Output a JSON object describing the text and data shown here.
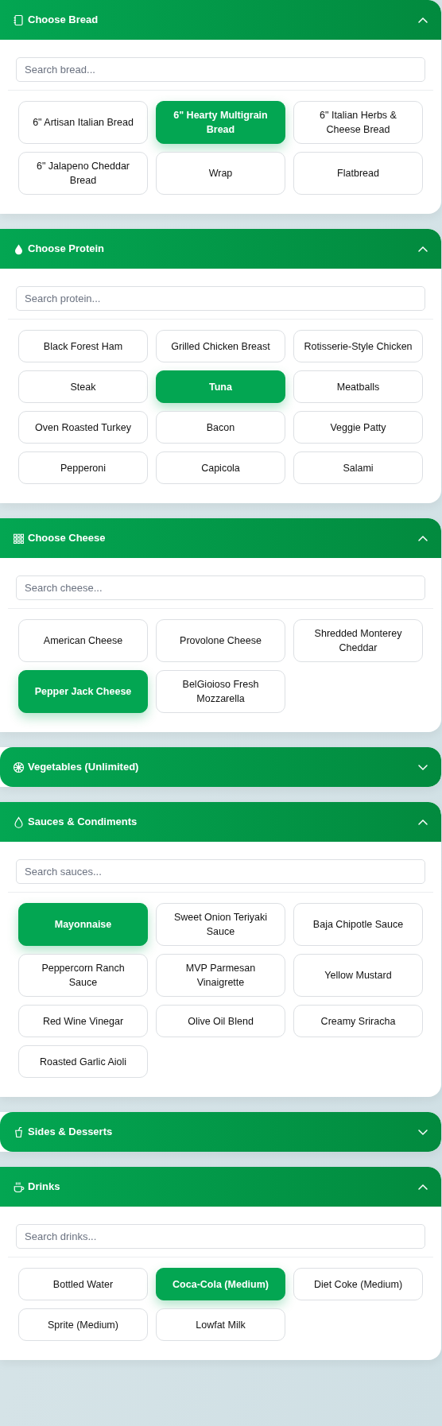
{
  "sections": [
    {
      "title": "Choose Bread",
      "expanded": true,
      "search": {
        "placeholder": "Search bread..."
      },
      "options": [
        {
          "label": "6\" Artisan Italian Bread",
          "selected": false
        },
        {
          "label": "6\" Hearty Multigrain Bread",
          "selected": true
        },
        {
          "label": "6\" Italian Herbs & Cheese Bread",
          "selected": false
        },
        {
          "label": "6\" Jalapeno Cheddar Bread",
          "selected": false
        },
        {
          "label": "Wrap",
          "selected": false
        },
        {
          "label": "Flatbread",
          "selected": false
        }
      ]
    },
    {
      "title": "Choose Protein",
      "expanded": true,
      "search": {
        "placeholder": "Search protein..."
      },
      "options": [
        {
          "label": "Black Forest Ham",
          "selected": false
        },
        {
          "label": "Grilled Chicken Breast",
          "selected": false
        },
        {
          "label": "Rotisserie-Style Chicken",
          "selected": false
        },
        {
          "label": "Steak",
          "selected": false
        },
        {
          "label": "Tuna",
          "selected": true
        },
        {
          "label": "Meatballs",
          "selected": false
        },
        {
          "label": "Oven Roasted Turkey",
          "selected": false
        },
        {
          "label": "Bacon",
          "selected": false
        },
        {
          "label": "Veggie Patty",
          "selected": false
        },
        {
          "label": "Pepperoni",
          "selected": false
        },
        {
          "label": "Capicola",
          "selected": false
        },
        {
          "label": "Salami",
          "selected": false
        }
      ]
    },
    {
      "title": "Choose Cheese",
      "expanded": true,
      "search": {
        "placeholder": "Search cheese..."
      },
      "options": [
        {
          "label": "American Cheese",
          "selected": false
        },
        {
          "label": "Provolone Cheese",
          "selected": false
        },
        {
          "label": "Shredded Monterey Cheddar",
          "selected": false
        },
        {
          "label": "Pepper Jack Cheese",
          "selected": true
        },
        {
          "label": "BelGioioso Fresh Mozzarella",
          "selected": false
        }
      ]
    },
    {
      "title": "Vegetables (Unlimited)",
      "expanded": false
    },
    {
      "title": "Sauces & Condiments",
      "expanded": true,
      "search": {
        "placeholder": "Search sauces..."
      },
      "options": [
        {
          "label": "Mayonnaise",
          "selected": true
        },
        {
          "label": "Sweet Onion Teriyaki Sauce",
          "selected": false
        },
        {
          "label": "Baja Chipotle Sauce",
          "selected": false
        },
        {
          "label": "Peppercorn Ranch Sauce",
          "selected": false
        },
        {
          "label": "MVP Parmesan Vinaigrette",
          "selected": false
        },
        {
          "label": "Yellow Mustard",
          "selected": false
        },
        {
          "label": "Red Wine Vinegar",
          "selected": false
        },
        {
          "label": "Olive Oil Blend",
          "selected": false
        },
        {
          "label": "Creamy Sriracha",
          "selected": false
        },
        {
          "label": "Roasted Garlic Aioli",
          "selected": false
        }
      ]
    },
    {
      "title": "Sides & Desserts",
      "expanded": false
    },
    {
      "title": "Drinks",
      "expanded": true,
      "search": {
        "placeholder": "Search drinks..."
      },
      "options": [
        {
          "label": "Bottled Water",
          "selected": false
        },
        {
          "label": "Coca-Cola (Medium)",
          "selected": true
        },
        {
          "label": "Diet Coke (Medium)",
          "selected": false
        },
        {
          "label": "Sprite (Medium)",
          "selected": false
        },
        {
          "label": "Lowfat Milk",
          "selected": false
        }
      ]
    }
  ]
}
